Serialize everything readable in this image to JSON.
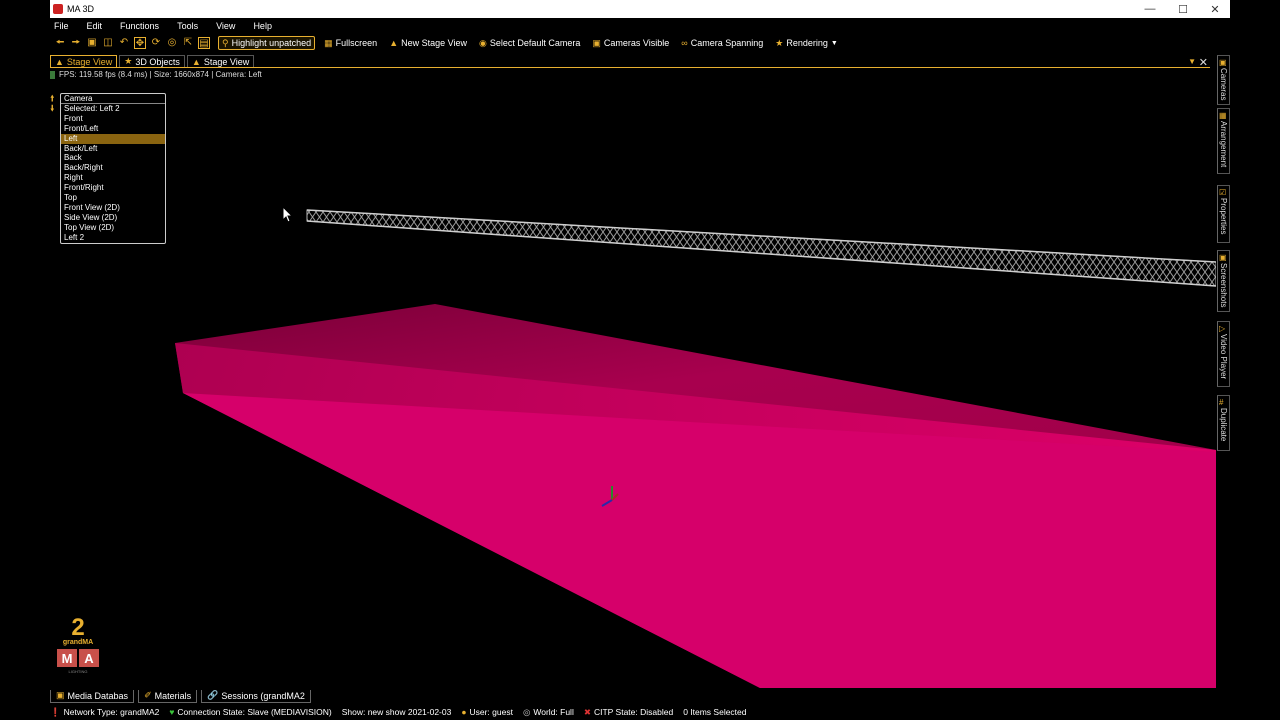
{
  "window": {
    "title": "MA 3D"
  },
  "menu": [
    "File",
    "Edit",
    "Functions",
    "Tools",
    "View",
    "Help"
  ],
  "toolbar": {
    "highlight_unpatched": "Highlight unpatched",
    "fullscreen": "Fullscreen",
    "new_stage_view": "New Stage View",
    "select_default_camera": "Select Default Camera",
    "cameras_visible": "Cameras Visible",
    "camera_spanning": "Camera Spanning",
    "rendering": "Rendering"
  },
  "tabs": [
    {
      "label": "Stage View"
    },
    {
      "label": "3D Objects"
    },
    {
      "label": "Stage View"
    }
  ],
  "status_line": "FPS: 119.58 fps (8.4 ms) | Size: 1660x874 | Camera: Left",
  "camera_list": {
    "header": "Camera",
    "items": [
      "Selected: Left 2",
      "Front",
      "Front/Left",
      "Left",
      "Back/Left",
      "Back",
      "Back/Right",
      "Right",
      "Front/Right",
      "Top",
      "Front View (2D)",
      "Side View (2D)",
      "Top View (2D)",
      "Left 2"
    ],
    "selected": "Left"
  },
  "side_tabs": [
    "Cameras",
    "Arrangement",
    "Properties",
    "Screenshots",
    "Video Player",
    "Duplicate"
  ],
  "logo": {
    "number": "2",
    "brand": "grandMA",
    "mark": "MA",
    "sub": "LIGHTING"
  },
  "bottom_tabs": [
    "Media Databas",
    "Materials",
    "Sessions (grandMA2"
  ],
  "statusbar": {
    "network": "Network Type: grandMA2",
    "connection": "Connection State: Slave (MEDIAVISION)",
    "show": "Show: new show 2021-02-03",
    "user": "User: guest",
    "world": "World: Full",
    "citp": "CITP State: Disabled",
    "selected": "0 Items Selected"
  },
  "colors": {
    "accent": "#e8b030",
    "stage": "#c0005a",
    "selection": "#8a6410"
  }
}
